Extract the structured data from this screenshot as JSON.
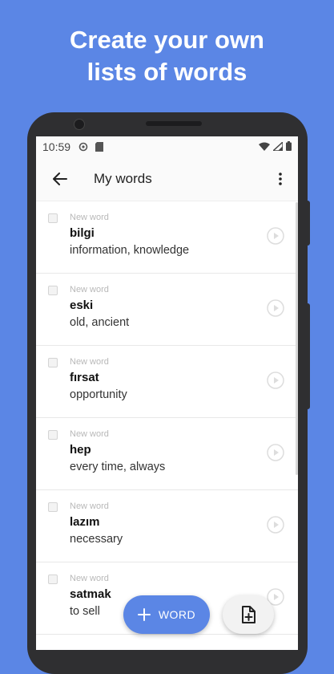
{
  "headline": {
    "line1": "Create your own",
    "line2": "lists of words"
  },
  "status": {
    "time": "10:59"
  },
  "appbar": {
    "title": "My words"
  },
  "words": [
    {
      "tag": "New word",
      "word": "bilgi",
      "meaning": "information, knowledge"
    },
    {
      "tag": "New word",
      "word": "eski",
      "meaning": "old, ancient"
    },
    {
      "tag": "New word",
      "word": "fırsat",
      "meaning": "opportunity"
    },
    {
      "tag": "New word",
      "word": "hep",
      "meaning": "every time, always"
    },
    {
      "tag": "New word",
      "word": "lazım",
      "meaning": "necessary"
    },
    {
      "tag": "New word",
      "word": "satmak",
      "meaning": "to sell"
    }
  ],
  "fab": {
    "add_word_label": "WORD"
  },
  "colors": {
    "accent": "#5b86e5"
  }
}
